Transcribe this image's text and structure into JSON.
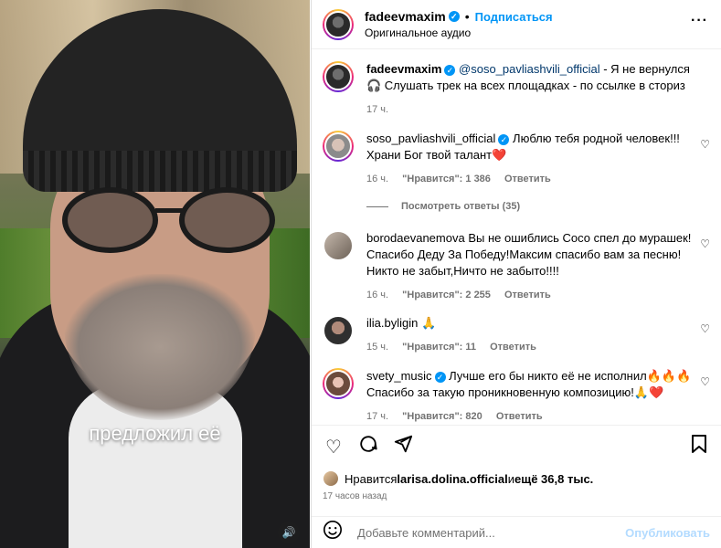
{
  "media": {
    "caption": "предложил её",
    "sound_icon": "speaker-icon"
  },
  "post": {
    "username": "fadeevmaxim",
    "separator": "•",
    "follow_label": "Подписаться",
    "audio_label": "Оригинальное аудио",
    "more_icon": "ellipsis-icon"
  },
  "caption": {
    "username": "fadeevmaxim",
    "mention": "@soso_pavliashvili_official",
    "text_line1": " - Я не вернулся",
    "text_line2": "🎧 Слушать трек на всех площадках - по ссылке в сториз",
    "time": "17 ч."
  },
  "comments": [
    {
      "username": "soso_pavliashvili_official",
      "verified": true,
      "text_line1": "Люблю тебя родной человек!!!",
      "text_line2": "Храни Бог твой талант❤️",
      "time": "16 ч.",
      "likes": "\"Нравится\": 1 386",
      "reply": "Ответить",
      "view_replies": "Посмотреть ответы (35)"
    },
    {
      "username": "borodaevanemova",
      "verified": false,
      "text_line1": "Вы не ошиблись Сосо спел до мурашек!",
      "text_line2": "Спасибо Деду За Победу!Максим спасибо вам за песню!",
      "text_line3": "Никто не забыт,Ничто не забыто!!!!",
      "time": "16 ч.",
      "likes": "\"Нравится\": 2 255",
      "reply": "Ответить"
    },
    {
      "username": "ilia.byligin",
      "verified": false,
      "text_line1": "🙏",
      "time": "15 ч.",
      "likes": "\"Нравится\": 11",
      "reply": "Ответить"
    },
    {
      "username": "svety_music",
      "verified": true,
      "text_line1": "Лучше его бы никто её не исполнил🔥🔥🔥",
      "text_line2": "Спасибо за такую проникновенную композицию!🙏❤️",
      "time": "17 ч.",
      "likes": "\"Нравится\": 820",
      "reply": "Ответить"
    }
  ],
  "actions": {
    "like_icon": "heart-icon",
    "comment_icon": "comment-bubble-icon",
    "share_icon": "paper-plane-icon",
    "save_icon": "bookmark-icon",
    "likes_prefix": "Нравится ",
    "likes_user": "larisa.dolina.official",
    "likes_suffix_a": " и ",
    "likes_suffix_b": "ещё 36,8 тыс.",
    "time_ago": "17 часов назад"
  },
  "add_comment": {
    "placeholder": "Добавьте комментарий...",
    "post_label": "Опубликовать",
    "emoji_icon": "smiley-icon"
  },
  "colors": {
    "accent": "#0095f6",
    "muted": "#737373",
    "post_disabled": "#b3dbff"
  }
}
